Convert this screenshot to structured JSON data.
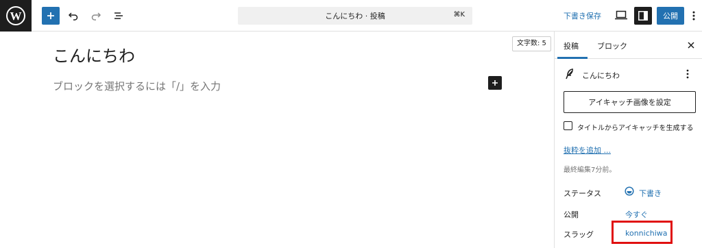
{
  "toolbar": {
    "command_title": "こんにちわ · 投稿",
    "command_shortcut": "⌘K",
    "save_draft_label": "下書き保存",
    "publish_label": "公開"
  },
  "editor": {
    "title": "こんにちわ",
    "word_count": "文字数: 5",
    "placeholder": "ブロックを選択するには「/」を入力"
  },
  "sidebar": {
    "tabs": [
      {
        "label": "投稿"
      },
      {
        "label": "ブロック"
      }
    ],
    "post_title": "こんにちわ",
    "featured_image_button": "アイキャッチ画像を設定",
    "generate_from_title": "タイトルからアイキャッチを生成する",
    "add_excerpt": "抜粋を追加 ...",
    "last_edited": "最終編集7分前。",
    "meta": {
      "status_label": "ステータス",
      "status_value": "下書き",
      "publish_label": "公開",
      "publish_value": "今すぐ",
      "slug_label": "スラッグ",
      "slug_value": "konnichiwa"
    }
  },
  "colors": {
    "accent": "#2271b1",
    "highlight": "#e00f0f",
    "dark": "#1e1e1e"
  },
  "icons": [
    "wordpress-logo-icon",
    "plus-icon",
    "undo-icon",
    "redo-icon",
    "list-view-icon",
    "desktop-preview-icon",
    "sidebar-toggle-icon",
    "more-options-icon",
    "close-icon",
    "feather-icon",
    "status-draft-icon"
  ]
}
